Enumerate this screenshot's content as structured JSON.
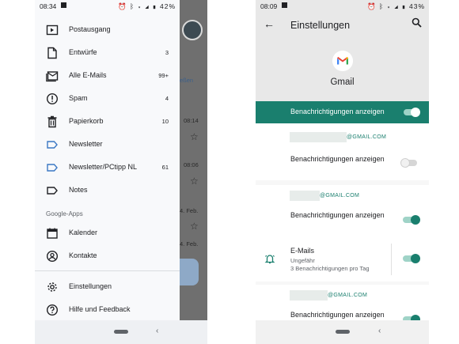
{
  "left_phone": {
    "status": {
      "time": "08:34",
      "battery": "42%"
    },
    "drawer_items": [
      {
        "label": "Postausgang",
        "count": "",
        "icon": "send-icon"
      },
      {
        "label": "Entwürfe",
        "count": "3",
        "icon": "draft-icon"
      },
      {
        "label": "Alle E-Mails",
        "count": "99+",
        "icon": "all-mail-icon"
      },
      {
        "label": "Spam",
        "count": "4",
        "icon": "spam-icon"
      },
      {
        "label": "Papierkorb",
        "count": "10",
        "icon": "trash-icon"
      },
      {
        "label": "Newsletter",
        "count": "",
        "icon": "label-icon"
      },
      {
        "label": "Newsletter/PCtipp NL",
        "count": "61",
        "icon": "label-icon"
      },
      {
        "label": "Notes",
        "count": "",
        "icon": "label-icon"
      }
    ],
    "section": "Google-Apps",
    "apps": [
      {
        "label": "Kalender",
        "icon": "calendar-icon"
      },
      {
        "label": "Kontakte",
        "icon": "contacts-icon"
      }
    ],
    "footer_items": [
      {
        "label": "Einstellungen",
        "icon": "gear-icon"
      },
      {
        "label": "Hilfe und Feedback",
        "icon": "help-icon"
      }
    ],
    "background": {
      "partial_text": "eßen",
      "times": [
        "08:14",
        "08:06",
        "4. Feb.",
        "4. Feb."
      ]
    }
  },
  "right_phone": {
    "status": {
      "time": "08:09",
      "battery": "43%"
    },
    "title": "Einstellungen",
    "app_name": "Gmail",
    "master_toggle": {
      "label": "Benachrichtigungen anzeigen",
      "on": true
    },
    "accounts": [
      {
        "domain": "@GMAIL.COM",
        "notify_label": "Benachrichtigungen anzeigen",
        "notify_on": false
      },
      {
        "domain": "@GMAIL.COM",
        "notify_label": "Benachrichtigungen anzeigen",
        "notify_on": true,
        "category": {
          "label": "E-Mails",
          "sub1": "Ungefähr",
          "sub2": "3 Benachrichtigungen pro Tag",
          "on": true
        }
      },
      {
        "domain": "@GMAIL.COM",
        "notify_label": "Benachrichtigungen anzeigen",
        "notify_on": true
      }
    ]
  },
  "colors": {
    "accent": "#1a7f6e",
    "drawer_bg": "#f8f9fb",
    "header_bg": "#e8e8e8"
  }
}
